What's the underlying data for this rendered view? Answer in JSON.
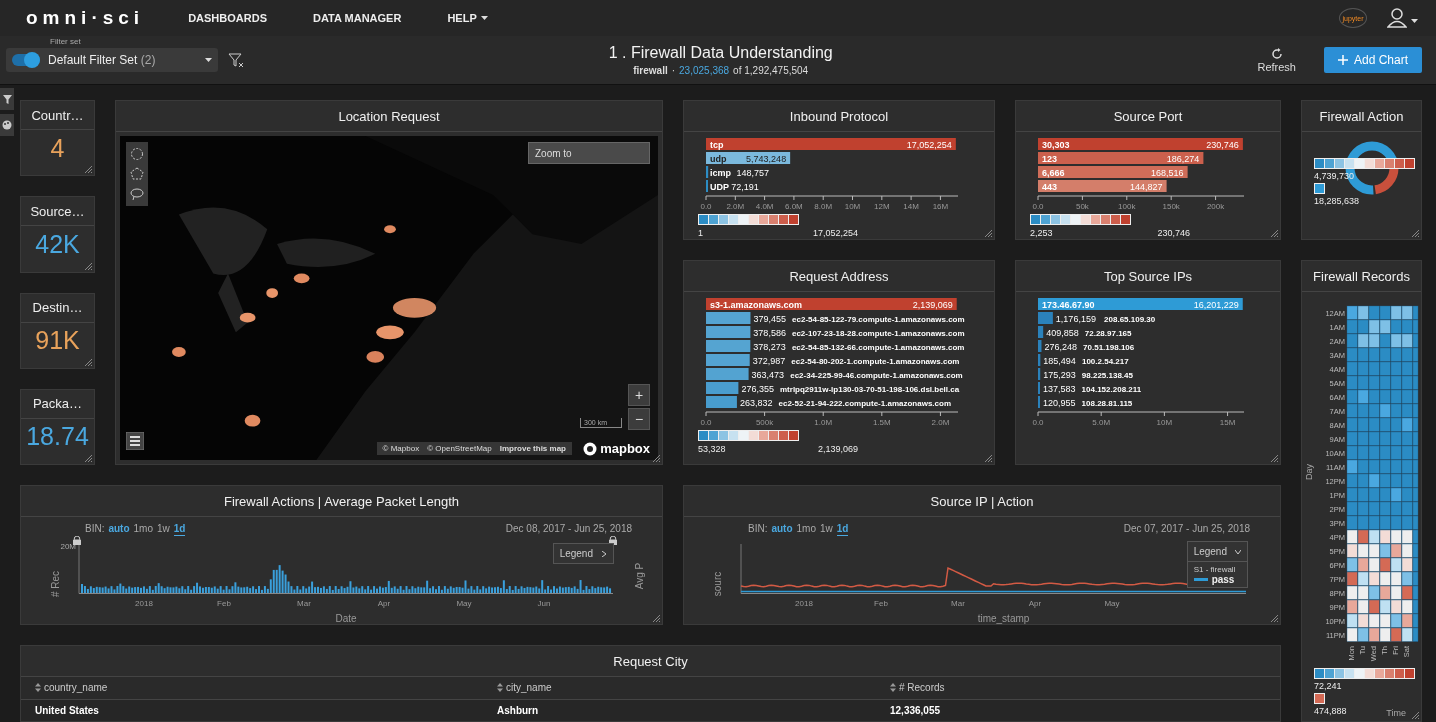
{
  "nav": {
    "logo": "omni·sci",
    "items": [
      {
        "label": "DASHBOARDS",
        "dropdown": false
      },
      {
        "label": "DATA MANAGER",
        "dropdown": false
      },
      {
        "label": "HELP",
        "dropdown": true
      }
    ],
    "jupyter": "jupyter"
  },
  "toolbar": {
    "filter_toggle": {
      "on": true
    },
    "filter_set": {
      "label": "Filter set",
      "value": "Default Filter Set",
      "count": "(2)"
    },
    "title": "1 . Firewall Data Understanding",
    "source": "firewall",
    "separator": "·",
    "filtered": "23,025,368",
    "total_text": "of 1,292,475,504",
    "refresh": "Refresh",
    "add_chart": "Add Chart"
  },
  "kpis": [
    {
      "title": "Countr…",
      "value": "4",
      "color": "#e8a25b"
    },
    {
      "title": "Source…",
      "value": "42K",
      "color": "#4aa8e0"
    },
    {
      "title": "Destin…",
      "value": "91K",
      "color": "#e8a25b"
    },
    {
      "title": "Packa…",
      "value": "18.74",
      "color": "#4aa8e0"
    }
  ],
  "map": {
    "title": "Location Request",
    "zoom_placeholder": "Zoom to",
    "zoom_in": "+",
    "zoom_out": "−",
    "scale": "300 km",
    "attribution": [
      "© Mapbox",
      "© OpenStreetMap",
      "Improve this map"
    ],
    "logo": "mapbox"
  },
  "bar_panels": [
    {
      "title": "Inbound Protocol",
      "legend": {
        "min": "1",
        "max": "17,052,254"
      },
      "chart_data": {
        "type": "bar",
        "orientation": "horizontal",
        "categories": [
          "tcp",
          "udp",
          "icmp",
          "UDP"
        ],
        "values": [
          17052254,
          5743248,
          148757,
          72191
        ],
        "value_labels": [
          "17,052,254",
          "5,743,248",
          "148,757",
          "72,191"
        ],
        "xlim": [
          0,
          17200000
        ],
        "xticks": [
          {
            "value": 0,
            "label": "0.0"
          },
          {
            "value": 2000000,
            "label": "2.0M"
          },
          {
            "value": 4000000,
            "label": "4.0M"
          },
          {
            "value": 6000000,
            "label": "6.0M"
          },
          {
            "value": 8000000,
            "label": "8.0M"
          },
          {
            "value": 10000000,
            "label": "10M"
          },
          {
            "value": 12000000,
            "label": "12M"
          },
          {
            "value": 14000000,
            "label": "14M"
          },
          {
            "value": 16000000,
            "label": "16M"
          }
        ],
        "data_labels": true
      }
    },
    {
      "title": "Source Port",
      "legend": {
        "min": "2,253",
        "max": "230,746"
      },
      "chart_data": {
        "type": "bar",
        "orientation": "horizontal",
        "categories": [
          "30,303",
          "123",
          "6,666",
          "443"
        ],
        "values": [
          230746,
          186274,
          168516,
          144827
        ],
        "value_labels": [
          "230,746",
          "186,274",
          "168,516",
          "144,827"
        ],
        "xlim": [
          0,
          232000
        ],
        "xticks": [
          {
            "value": 0,
            "label": "0.0"
          },
          {
            "value": 50000,
            "label": "50k"
          },
          {
            "value": 100000,
            "label": "100k"
          },
          {
            "value": 150000,
            "label": "150k"
          },
          {
            "value": 200000,
            "label": "200k"
          }
        ],
        "data_labels": true
      }
    },
    {
      "title": "Request Address",
      "legend": {
        "min": "53,328",
        "max": "2,139,069"
      },
      "chart_data": {
        "type": "bar",
        "orientation": "horizontal",
        "categories": [
          "s3-1.amazonaws.com",
          "ec2-54-85-122-79.compute-1.amazonaws.com",
          "ec2-107-23-18-28.compute-1.amazonaws.com",
          "ec2-54-85-132-66.compute-1.amazonaws.com",
          "ec2-54-80-202-1.compute-1.amazonaws.com",
          "ec2-34-225-99-46.compute-1.amazonaws.com",
          "mtrlpq2911w-lp130-03-70-51-198-106.dsl.bell.ca",
          "ec2-52-21-94-222.compute-1.amazonaws.com"
        ],
        "values": [
          2139069,
          379455,
          378586,
          378273,
          372987,
          363473,
          276355,
          263832
        ],
        "value_labels": [
          "2,139,069",
          "379,455",
          "378,586",
          "378,273",
          "372,987",
          "363,473",
          "276,355",
          "263,832"
        ],
        "xlim": [
          0,
          2150000
        ],
        "xticks": [
          {
            "value": 0,
            "label": "0.0"
          },
          {
            "value": 500000,
            "label": "500k"
          },
          {
            "value": 1000000,
            "label": "1.0M"
          },
          {
            "value": 1500000,
            "label": "1.5M"
          },
          {
            "value": 2000000,
            "label": "2.0M"
          }
        ],
        "data_labels": true
      }
    },
    {
      "title": "Top Source IPs",
      "chart_data": {
        "type": "bar",
        "orientation": "horizontal",
        "categories": [
          "173.46.67.90",
          "208.65.109.30",
          "72.28.97.165",
          "70.51.198.106",
          "100.2.54.217",
          "98.225.138.45",
          "104.152.208.211",
          "108.28.81.115"
        ],
        "values": [
          16201229,
          1176159,
          409858,
          276248,
          185494,
          175293,
          137583,
          120955
        ],
        "value_labels": [
          "16,201,229",
          "1,176,159",
          "409,858",
          "276,248",
          "185,494",
          "175,293",
          "137,583",
          "120,955"
        ],
        "xlim": [
          0,
          16300000
        ],
        "xticks": [
          {
            "value": 0,
            "label": "0.0"
          },
          {
            "value": 5000000,
            "label": "5.0M"
          },
          {
            "value": 10000000,
            "label": "10M"
          },
          {
            "value": 15000000,
            "label": "15M"
          }
        ],
        "data_labels": true
      }
    }
  ],
  "firewall_action": {
    "title": "Firewall Action",
    "legend": {
      "min": "4,739,730",
      "max": "18,285,638"
    }
  },
  "firewall_records": {
    "title": "Firewall Records",
    "y_title": "Day",
    "x_title": "Time",
    "rows": [
      "12AM",
      "1AM",
      "2AM",
      "3AM",
      "4AM",
      "5AM",
      "6AM",
      "7AM",
      "8AM",
      "9AM",
      "10AM",
      "11AM",
      "12PM",
      "1PM",
      "2PM",
      "3PM",
      "4PM",
      "5PM",
      "6PM",
      "7PM",
      "8PM",
      "9PM",
      "10PM",
      "11PM"
    ],
    "columns": [
      "Mon",
      "Tu",
      "Wed",
      "Th",
      "Fri",
      "Sat"
    ],
    "legend": {
      "min": "72,241",
      "max": "474,888"
    }
  },
  "time_panels": [
    {
      "title": "Firewall Actions | Average Packet Length",
      "kind": "histogram",
      "bin_label": "BIN:",
      "bins": [
        {
          "label": "auto",
          "highlighted": true,
          "selected": false
        },
        {
          "label": "1mo",
          "highlighted": false,
          "selected": false
        },
        {
          "label": "1w",
          "highlighted": false,
          "selected": false
        },
        {
          "label": "1d",
          "highlighted": true,
          "selected": true
        }
      ],
      "range": "Dec 08, 2017 - Jun 25, 2018",
      "ylabel": "# Rec",
      "y2label": "Avg P",
      "ytick": "20M",
      "xlabels": [
        "2018",
        "Feb",
        "Mar",
        "Apr",
        "May",
        "Jun"
      ],
      "xlabel": "Date",
      "legend": {
        "title": "Legend",
        "expanded": false
      }
    },
    {
      "title": "Source IP | Action",
      "kind": "line",
      "bin_label": "BIN:",
      "bins": [
        {
          "label": "auto",
          "highlighted": true,
          "selected": false
        },
        {
          "label": "1mo",
          "highlighted": false,
          "selected": false
        },
        {
          "label": "1w",
          "highlighted": false,
          "selected": false
        },
        {
          "label": "1d",
          "highlighted": true,
          "selected": true
        }
      ],
      "range": "Dec 07, 2017 - Jun 25, 2018",
      "ylabel": "sourc",
      "xlabels": [
        "2018",
        "Feb",
        "Mar",
        "Apr",
        "May"
      ],
      "xlabel": "time_stamp",
      "legend": {
        "title": "Legend",
        "expanded": true,
        "group": "S1 - firewall",
        "item": "pass"
      }
    }
  ],
  "table": {
    "title": "Request City",
    "columns": [
      "country_name",
      "city_name",
      "# Records"
    ],
    "rows": [
      [
        "United States",
        "Ashburn",
        "12,336,055"
      ]
    ]
  }
}
